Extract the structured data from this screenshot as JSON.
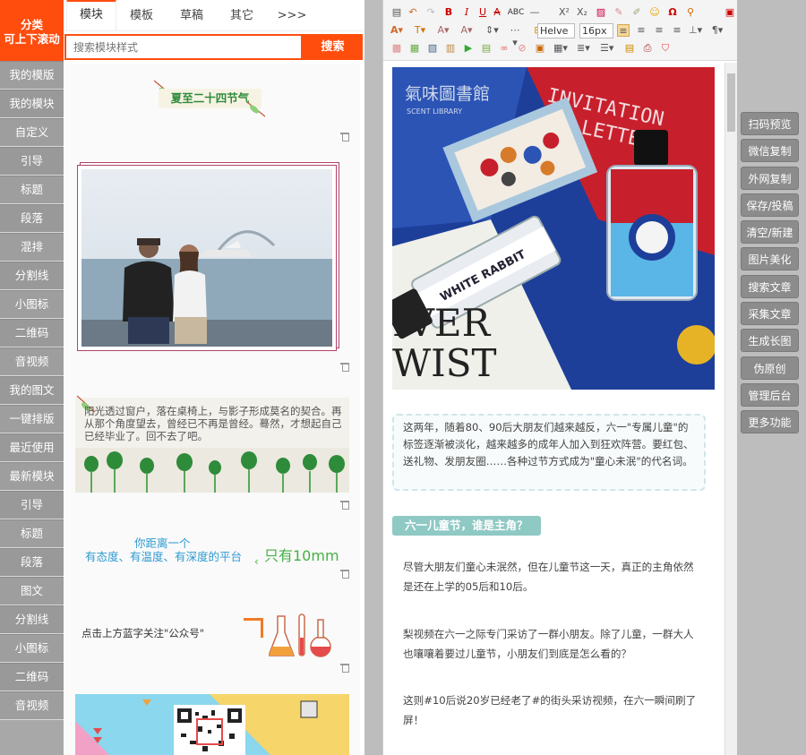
{
  "sidebar": {
    "head_line1": "分类",
    "head_line2": "可上下滚动",
    "items": [
      "我的模版",
      "我的模块",
      "自定义",
      "引导",
      "标题",
      "段落",
      "混排",
      "分割线",
      "小图标",
      "二维码",
      "音视频",
      "我的图文",
      "一键排版",
      "最近使用",
      "最新模块",
      "引导",
      "标题",
      "段落",
      "图文",
      "分割线",
      "小图标",
      "二维码",
      "音视频"
    ]
  },
  "panel": {
    "tabs": [
      "模块",
      "模板",
      "草稿",
      "其它",
      ">>>"
    ],
    "search_placeholder": "搜索模块样式",
    "search_button": "搜索",
    "modules": {
      "m1_title": "夏至二十四节气",
      "m3_text": "阳光透过窗户，落在桌椅上，与影子形成莫名的契合。再从那个角度望去，曾经已不再是曾经。蓦然，才想起自己已经毕业了。回不去了吧。",
      "m4_line1": "你距离一个",
      "m4_line2": "有态度、有温度、有深度的平台",
      "m4_big": "只有10mm",
      "m5_text": "点击上方蓝字关注\"公众号\""
    }
  },
  "editor": {
    "font_name": "Helve",
    "font_size": "16px",
    "image_brand": "氣味圖書館",
    "image_brand_en": "SCENT LIBRARY",
    "image_invitation": "INVITATION",
    "image_letter": "LETTER",
    "image_rabbit": "WHITE RABBIT",
    "image_wist": "WIST",
    "image_iver": "IVER",
    "intro": "这两年，随着80、90后大朋友们越来越反，六一\"专属儿童\"的标签逐渐被淡化，越来越多的成年人加入到狂欢阵营。要红包、送礼物、发朋友圈……各种过节方式成为\"童心未泯\"的代名词。",
    "heading": "六一儿童节，谁是主角？",
    "p1": "尽管大朋友们童心未泯然，但在儿童节这一天，真正的主角依然是还在上学的05后和10后。",
    "p2": "梨视频在六一之际专门采访了一群小朋友。除了儿童，一群大人也嚷嚷着要过儿童节，小朋友们到底是怎么看的？",
    "p3": "这则#10后说20岁已经老了#的街头采访视频，在六一瞬间刷了屏！"
  },
  "actions": [
    "扫码预览",
    "微信复制",
    "外网复制",
    "保存/投稿",
    "清空/新建",
    "图片美化",
    "搜索文章",
    "采集文章",
    "生成长图",
    "伪原创",
    "管理后台",
    "更多功能"
  ],
  "colors": {
    "accent": "#ff4d0e",
    "teal": "#8fc9c4"
  }
}
